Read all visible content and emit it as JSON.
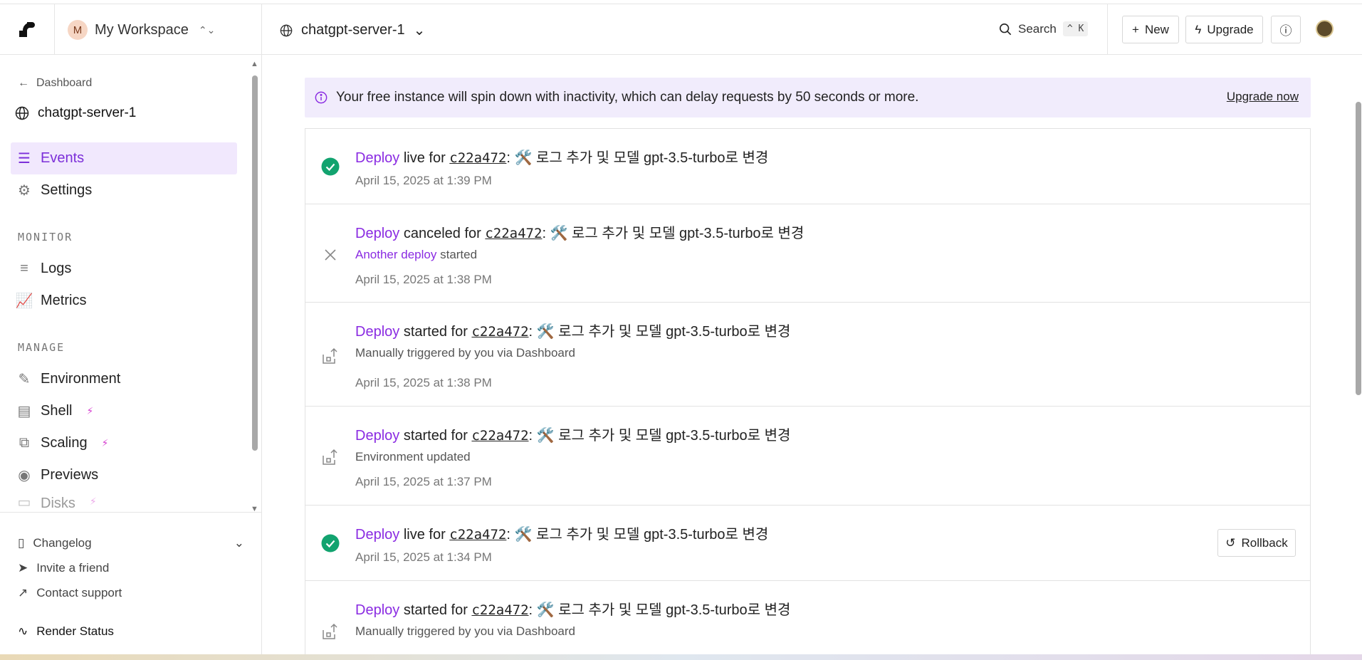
{
  "workspace": {
    "initial": "M",
    "name": "My Workspace"
  },
  "sidebar": {
    "back_label": "Dashboard",
    "service_name": "chatgpt-server-1",
    "nav_top": [
      {
        "label": "Events",
        "icon": "list-icon",
        "active": true
      },
      {
        "label": "Settings",
        "icon": "gear-icon",
        "active": false
      }
    ],
    "monitor_label": "MONITOR",
    "monitor": [
      {
        "label": "Logs",
        "icon": "logs-icon"
      },
      {
        "label": "Metrics",
        "icon": "chart-icon"
      }
    ],
    "manage_label": "MANAGE",
    "manage": [
      {
        "label": "Environment",
        "icon": "edit-icon",
        "bolt": false
      },
      {
        "label": "Shell",
        "icon": "terminal-icon",
        "bolt": true
      },
      {
        "label": "Scaling",
        "icon": "scaling-icon",
        "bolt": true
      },
      {
        "label": "Previews",
        "icon": "eye-icon",
        "bolt": false
      },
      {
        "label": "Disks",
        "icon": "disk-icon",
        "bolt": true
      }
    ],
    "footer": {
      "changelog": "Changelog",
      "invite": "Invite a friend",
      "support": "Contact support",
      "status": "Render Status"
    }
  },
  "header": {
    "service": "chatgpt-server-1",
    "search_label": "Search",
    "search_shortcut": "^ K",
    "new_label": "New",
    "upgrade_label": "Upgrade"
  },
  "banner": {
    "text": "Your free instance will spin down with inactivity, which can delay requests by 50 seconds or more.",
    "link": "Upgrade now"
  },
  "events": [
    {
      "status": "live",
      "kind": "Deploy",
      "verb": "live for",
      "hash": "c22a472",
      "message": "🛠️ 로그 추가 및 모델 gpt-3.5-turbo로 변경",
      "sub_link": "",
      "sub": "",
      "time": "April 15, 2025 at 1:39 PM",
      "rollback": ""
    },
    {
      "status": "canceled",
      "kind": "Deploy",
      "verb": "canceled for",
      "hash": "c22a472",
      "message": "🛠️ 로그 추가 및 모델 gpt-3.5-turbo로 변경",
      "sub_link": "Another deploy",
      "sub": " started",
      "time": "April 15, 2025 at 1:38 PM",
      "rollback": ""
    },
    {
      "status": "started",
      "kind": "Deploy",
      "verb": "started for",
      "hash": "c22a472",
      "message": "🛠️ 로그 추가 및 모델 gpt-3.5-turbo로 변경",
      "sub_link": "",
      "sub": "Manually triggered by you via Dashboard",
      "time": "April 15, 2025 at 1:38 PM",
      "rollback": ""
    },
    {
      "status": "started",
      "kind": "Deploy",
      "verb": "started for",
      "hash": "c22a472",
      "message": "🛠️ 로그 추가 및 모델 gpt-3.5-turbo로 변경",
      "sub_link": "",
      "sub": "Environment updated",
      "time": "April 15, 2025 at 1:37 PM",
      "rollback": ""
    },
    {
      "status": "live",
      "kind": "Deploy",
      "verb": "live for",
      "hash": "c22a472",
      "message": "🛠️ 로그 추가 및 모델 gpt-3.5-turbo로 변경",
      "sub_link": "",
      "sub": "",
      "time": "April 15, 2025 at 1:34 PM",
      "rollback": "Rollback"
    },
    {
      "status": "started",
      "kind": "Deploy",
      "verb": "started for",
      "hash": "c22a472",
      "message": "🛠️ 로그 추가 및 모델 gpt-3.5-turbo로 변경",
      "sub_link": "",
      "sub": "Manually triggered by you via Dashboard",
      "time": "",
      "rollback": ""
    }
  ],
  "colors": {
    "accent": "#8a2be2",
    "active_bg": "#f1e8fd",
    "live": "#12a36f",
    "banner_bg": "#f1ecfc"
  }
}
